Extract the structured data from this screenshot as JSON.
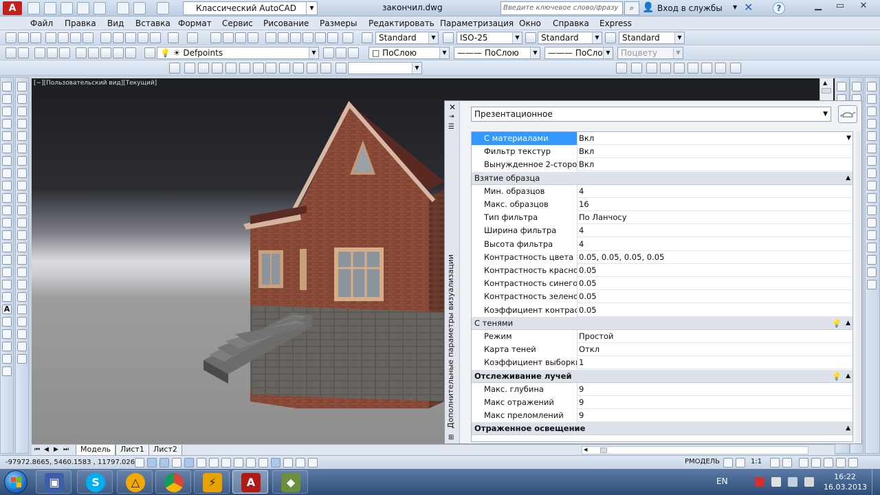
{
  "titlebar": {
    "workspace": "Классический AutoCAD",
    "document": "закончил.dwg",
    "search_placeholder": "Введите ключевое слово/фразу",
    "login": "Вход в службы"
  },
  "menu": [
    "Файл",
    "Правка",
    "Вид",
    "Вставка",
    "Формат",
    "Сервис",
    "Рисование",
    "Размеры",
    "Редактировать",
    "Параметризация",
    "Окно",
    "Справка",
    "Express"
  ],
  "styles": {
    "text_style": "Standard",
    "dim_style": "ISO-25",
    "table_style": "Standard",
    "mleader_style": "Standard"
  },
  "layers": {
    "current_layer": "Defpoints",
    "color": "ПоСлою",
    "linetype": "ПоСлою",
    "lineweight": "ПоСлою",
    "plot_style": "Поцвету"
  },
  "viewport": {
    "label": "[−][Пользовательский вид][Текущий]"
  },
  "palette": {
    "vertical_title": "Дополнительные параметры визуализации",
    "preset": "Презентационное",
    "rows": [
      {
        "kind": "prop",
        "name": "С материалами",
        "value": "Вкл",
        "selected": true
      },
      {
        "kind": "prop",
        "name": "Фильтр текстур",
        "value": "Вкл"
      },
      {
        "kind": "prop",
        "name": "Вынужденное 2-сторо...",
        "value": "Вкл"
      },
      {
        "kind": "cat",
        "name": "Взятие образца",
        "bold": false,
        "bulb": false
      },
      {
        "kind": "prop",
        "name": "Мин. образцов",
        "value": "4"
      },
      {
        "kind": "prop",
        "name": "Макс. образцов",
        "value": "16"
      },
      {
        "kind": "prop",
        "name": "Тип фильтра",
        "value": "По Ланчосу"
      },
      {
        "kind": "prop",
        "name": "Ширина фильтра",
        "value": "4"
      },
      {
        "kind": "prop",
        "name": "Высота фильтра",
        "value": "4"
      },
      {
        "kind": "prop",
        "name": "Контрастность цвета",
        "value": "0.05, 0.05, 0.05, 0.05"
      },
      {
        "kind": "prop",
        "name": "Контрастность красно...",
        "value": "0.05"
      },
      {
        "kind": "prop",
        "name": "Контрастность синего",
        "value": "0.05"
      },
      {
        "kind": "prop",
        "name": "Контрастность зелено...",
        "value": "0.05"
      },
      {
        "kind": "prop",
        "name": "Коэффициент контраст...",
        "value": "0.05"
      },
      {
        "kind": "cat",
        "name": "С тенями",
        "bold": false,
        "bulb": true
      },
      {
        "kind": "prop",
        "name": "Режим",
        "value": "Простой"
      },
      {
        "kind": "prop",
        "name": "Карта теней",
        "value": "Откл"
      },
      {
        "kind": "prop",
        "name": "Коэффициент выборки",
        "value": "1"
      },
      {
        "kind": "cat",
        "name": "Отслеживание лучей",
        "bold": true,
        "bulb": true
      },
      {
        "kind": "prop",
        "name": "Макс. глубина",
        "value": "9"
      },
      {
        "kind": "prop",
        "name": "Макс отражений",
        "value": "9"
      },
      {
        "kind": "prop",
        "name": "Макс преломлений",
        "value": "9"
      },
      {
        "kind": "cat",
        "name": "Отраженное освещение",
        "bold": true,
        "bulb": false
      }
    ]
  },
  "tabs": [
    "Модель",
    "Лист1",
    "Лист2"
  ],
  "status": {
    "coords": "-97972.8665, 5460.1583 , 11797.0267",
    "space": "РМОДЕЛЬ",
    "scale": "1:1"
  },
  "taskbar": {
    "lang": "EN",
    "time": "16:22",
    "date": "16.03.2013"
  },
  "colors": {
    "accent_selected": "#3399ff",
    "autocad_red": "#c2201b"
  }
}
